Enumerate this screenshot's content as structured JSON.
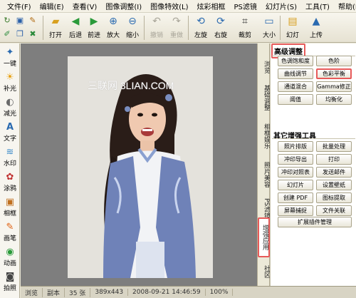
{
  "menu": {
    "items": [
      "文件(F)",
      "编辑(E)",
      "查看(V)",
      "图像调整(I)",
      "图像特效(L)",
      "炫彩相框",
      "PS滤镜",
      "幻灯片(S)",
      "工具(T)",
      "帮助(H)"
    ]
  },
  "toolbar": {
    "buttons": [
      {
        "label": "打开",
        "icon": "folder-open-icon"
      },
      {
        "label": "后退",
        "icon": "arrow-left-icon"
      },
      {
        "label": "前进",
        "icon": "arrow-right-icon"
      },
      {
        "label": "放大",
        "icon": "zoom-in-icon"
      },
      {
        "label": "缩小",
        "icon": "zoom-out-icon"
      },
      {
        "label": "撤销",
        "icon": "undo-icon"
      },
      {
        "label": "重做",
        "icon": "redo-icon"
      },
      {
        "label": "左旋",
        "icon": "rotate-left-icon"
      },
      {
        "label": "右旋",
        "icon": "rotate-right-icon"
      },
      {
        "label": "裁剪",
        "icon": "crop-icon"
      },
      {
        "label": "大小",
        "icon": "resize-icon"
      },
      {
        "label": "幻灯",
        "icon": "slideshow-icon"
      },
      {
        "label": "上传",
        "icon": "upload-icon"
      }
    ]
  },
  "left_panel": {
    "items": [
      "一键",
      "补光",
      "减光",
      "文字",
      "水印",
      "涂鸦",
      "相框",
      "画笔",
      "动画",
      "拍照"
    ]
  },
  "canvas": {
    "watermark": "三联网 3LIAN.COM"
  },
  "status": {
    "items": [
      "浏览",
      "副本",
      "35 张",
      "389x443",
      "2008-09-21 14:46:59",
      "100%"
    ]
  },
  "vtabs": [
    "浏览",
    "基础调整",
    "相框娱乐",
    "照片美容",
    "PS滤镜",
    "增强应用",
    "社区"
  ],
  "right_panel": {
    "section1_title": "高级调整",
    "section1_buttons": [
      "色调饱和度",
      "色阶",
      "曲线调节",
      "色彩平衡",
      "通道混合",
      "Gamma修正",
      "阈值",
      "均衡化"
    ],
    "section2_title": "其它增强工具",
    "section2_buttons": [
      "照片排版",
      "批量处理",
      "冲印导出",
      "打印",
      "冲印对照表",
      "发送邮件",
      "幻灯片",
      "设置壁纸",
      "创建 PDF",
      "图标提取",
      "屏幕捕捉",
      "文件关联"
    ],
    "plugin_button": "扩展插件管理"
  },
  "colors": {
    "highlight": "#e75a5a",
    "canvas_bg": "#7e7e7e"
  }
}
